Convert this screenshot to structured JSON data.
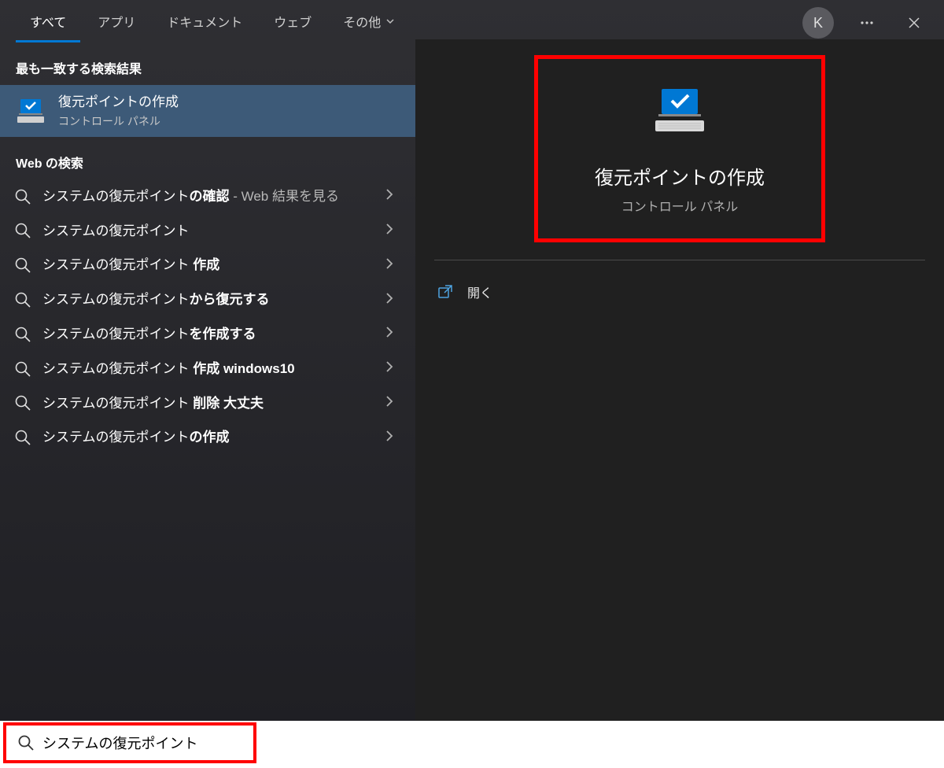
{
  "tabs": [
    {
      "label": "すべて",
      "active": true
    },
    {
      "label": "アプリ",
      "active": false
    },
    {
      "label": "ドキュメント",
      "active": false
    },
    {
      "label": "ウェブ",
      "active": false
    },
    {
      "label": "その他",
      "active": false,
      "dropdown": true
    }
  ],
  "header": {
    "avatar_letter": "K"
  },
  "sections": {
    "best_match": "最も一致する検索結果",
    "web_search": "Web の検索"
  },
  "best_match_item": {
    "title": "復元ポイントの作成",
    "subtitle": "コントロール パネル"
  },
  "web_results": [
    {
      "prefix": "システムの復元ポイント",
      "bold": "の確認",
      "suffix": " - Web 結果を見る"
    },
    {
      "prefix": "システムの復元ポイント",
      "bold": "",
      "suffix": ""
    },
    {
      "prefix": "システムの復元ポイント ",
      "bold": "作成",
      "suffix": ""
    },
    {
      "prefix": "システムの復元ポイント",
      "bold": "から復元する",
      "suffix": ""
    },
    {
      "prefix": "システムの復元ポイント",
      "bold": "を作成する",
      "suffix": ""
    },
    {
      "prefix": "システムの復元ポイント ",
      "bold": "作成 windows10",
      "suffix": ""
    },
    {
      "prefix": "システムの復元ポイント ",
      "bold": "削除 大丈夫",
      "suffix": ""
    },
    {
      "prefix": "システムの復元ポイント",
      "bold": "の作成",
      "suffix": ""
    }
  ],
  "preview": {
    "title": "復元ポイントの作成",
    "subtitle": "コントロール パネル"
  },
  "actions": {
    "open": "開く"
  },
  "search": {
    "value": "システムの復元ポイント"
  }
}
